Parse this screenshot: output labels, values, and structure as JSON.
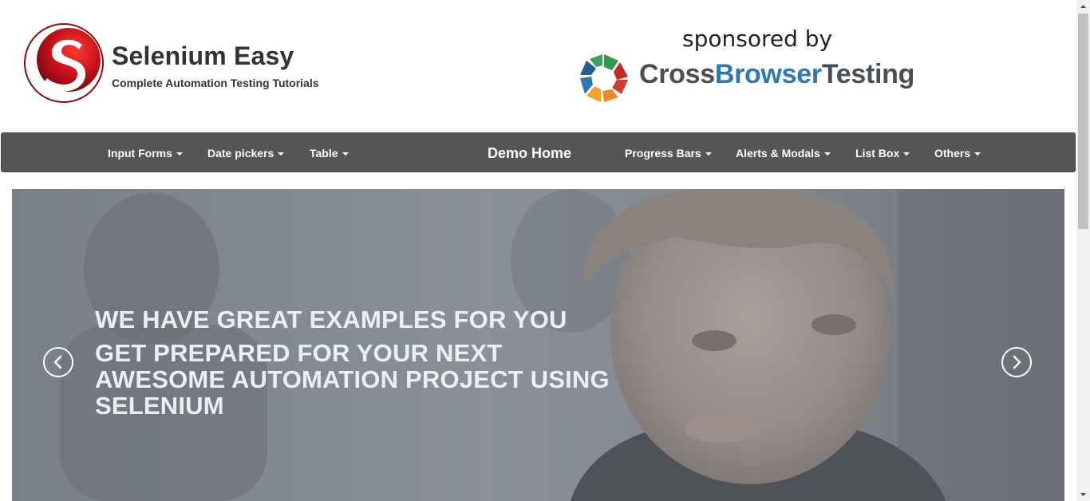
{
  "brand": {
    "title": "Selenium Easy",
    "tagline": "Complete Automation Testing Tutorials",
    "logo_icon": "selenium-easy-logo-icon",
    "logo_color": "#c0101a"
  },
  "sponsor": {
    "label": "sponsored by",
    "name_part1": "Cross",
    "name_part2": "Browser",
    "name_part3": "Testing",
    "logo_icon": "crossbrowsertesting-logo-icon"
  },
  "navbar": {
    "background": "#555555",
    "items_left": [
      {
        "label": "Input Forms"
      },
      {
        "label": "Date pickers"
      },
      {
        "label": "Table"
      }
    ],
    "home": "Demo Home",
    "items_right": [
      {
        "label": "Progress Bars"
      },
      {
        "label": "Alerts & Modals"
      },
      {
        "label": "List Box"
      },
      {
        "label": "Others"
      }
    ]
  },
  "carousel": {
    "heading": "WE HAVE GREAT EXAMPLES FOR YOU",
    "subheading": "GET PREPARED FOR YOUR NEXT AWESOME AUTOMATION PROJECT USING SELENIUM",
    "prev_icon": "chevron-left-icon",
    "next_icon": "chevron-right-icon"
  }
}
